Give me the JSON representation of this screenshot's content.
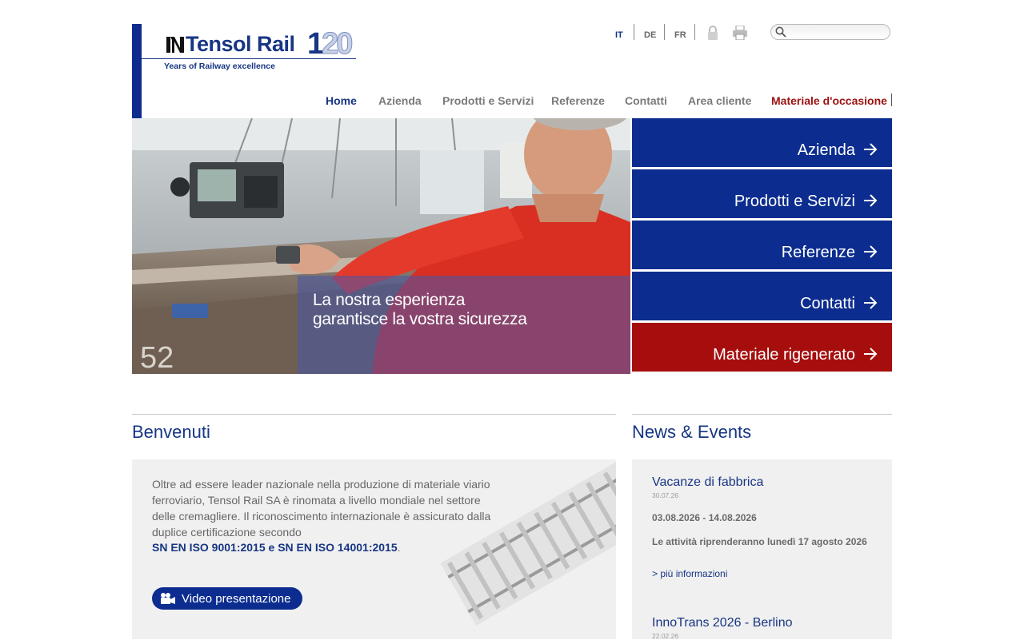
{
  "brand": {
    "name": "Tensol Rail",
    "number": "120",
    "tagline": "Years of Railway excellence",
    "color": "#173583"
  },
  "top": {
    "languages": [
      "IT",
      "DE",
      "FR"
    ],
    "active_language": "IT",
    "icons": [
      "lock-icon",
      "print-icon"
    ],
    "search_placeholder": ""
  },
  "nav": [
    {
      "label": "Home"
    },
    {
      "label": "Azienda"
    },
    {
      "label": "Prodotti e Servizi"
    },
    {
      "label": "Referenze"
    },
    {
      "label": "Contatti"
    },
    {
      "label": "Area cliente"
    },
    {
      "label": "Materiale d'occasione"
    }
  ],
  "hero": {
    "caption_line1": "La nostra esperienza",
    "caption_line2": "garantisce la vostra sicurezza"
  },
  "tiles": [
    {
      "label": "Azienda",
      "color": "#0c2d8f"
    },
    {
      "label": "Prodotti e Servizi",
      "color": "#0c2d8f"
    },
    {
      "label": "Referenze",
      "color": "#0c2d8f"
    },
    {
      "label": "Contatti",
      "color": "#0c2d8f"
    },
    {
      "label": "Materiale rigenerato",
      "color": "#a60e0e"
    }
  ],
  "welcome": {
    "title": "Benvenuti",
    "text": "Oltre ad essere leader nazionale nella produzione di materiale viario ferroviario, Tensol Rail SA è rinomata a livello mondiale nel settore delle cremagliere. Il riconoscimento internazionale è assicurato dalla duplice certificazione secondo",
    "iso": "SN EN ISO 9001:2015 e SN EN ISO 14001:2015",
    "iso_suffix": ".",
    "video_button": "Video presentazione"
  },
  "news": {
    "title": "News & Events",
    "items": [
      {
        "title": "Vacanze di fabbrica",
        "date": "30.07.26",
        "period": "03.08.2026 - 14.08.2026",
        "note": "Le attività riprenderanno lunedì 17 agosto 2026",
        "link": "> più informazioni"
      },
      {
        "title": "InnoTrans 2026 - Berlino",
        "date": "22.02.26"
      }
    ]
  }
}
